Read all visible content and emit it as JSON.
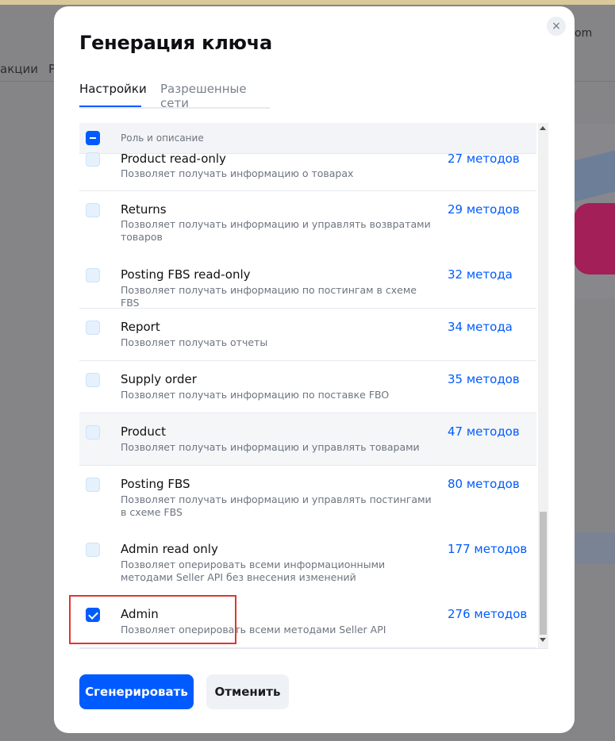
{
  "background": {
    "nav_left": "акции",
    "nav_right": "Р",
    "top_right_text": "om"
  },
  "modal": {
    "title": "Генерация ключа",
    "close_icon": "×",
    "tabs": [
      {
        "label": "Настройки",
        "active": true
      },
      {
        "label": "Разрешенные сети",
        "active": false
      }
    ],
    "table": {
      "header_label": "Роль и описание",
      "header_checkbox": "indeterminate",
      "rows": [
        {
          "name": "Product read-only",
          "desc": "Позволяет получать информацию о товарах",
          "methods": "27 методов",
          "checked": false
        },
        {
          "name": "Returns",
          "desc": "Позволяет получать информацию и управлять возвратами товаров",
          "methods": "29 методов",
          "checked": false
        },
        {
          "name": "Posting FBS read-only",
          "desc": "Позволяет получать информацию по постингам в схеме FBS",
          "methods": "32 метода",
          "checked": false
        },
        {
          "name": "Report",
          "desc": "Позволяет получать отчеты",
          "methods": "34 метода",
          "checked": false
        },
        {
          "name": "Supply order",
          "desc": "Позволяет получать информацию по поставке FBO",
          "methods": "35 методов",
          "checked": false
        },
        {
          "name": "Product",
          "desc": "Позволяет получать информацию и управлять товарами",
          "methods": "47 методов",
          "checked": false
        },
        {
          "name": "Posting FBS",
          "desc": "Позволяет получать информацию и управлять постингами в схеме FBS",
          "methods": "80 методов",
          "checked": false
        },
        {
          "name": "Admin read only",
          "desc": "Позволяет оперировать всеми информационными методами Seller API без внесения изменений",
          "methods": "177 методов",
          "checked": false
        },
        {
          "name": "Admin",
          "desc": "Позволяет оперировать всеми методами Seller API",
          "methods": "276 методов",
          "checked": true
        }
      ]
    },
    "buttons": {
      "generate": "Сгенерировать",
      "cancel": "Отменить"
    }
  },
  "colors": {
    "accent": "#005bff",
    "highlight": "#e3342f"
  }
}
